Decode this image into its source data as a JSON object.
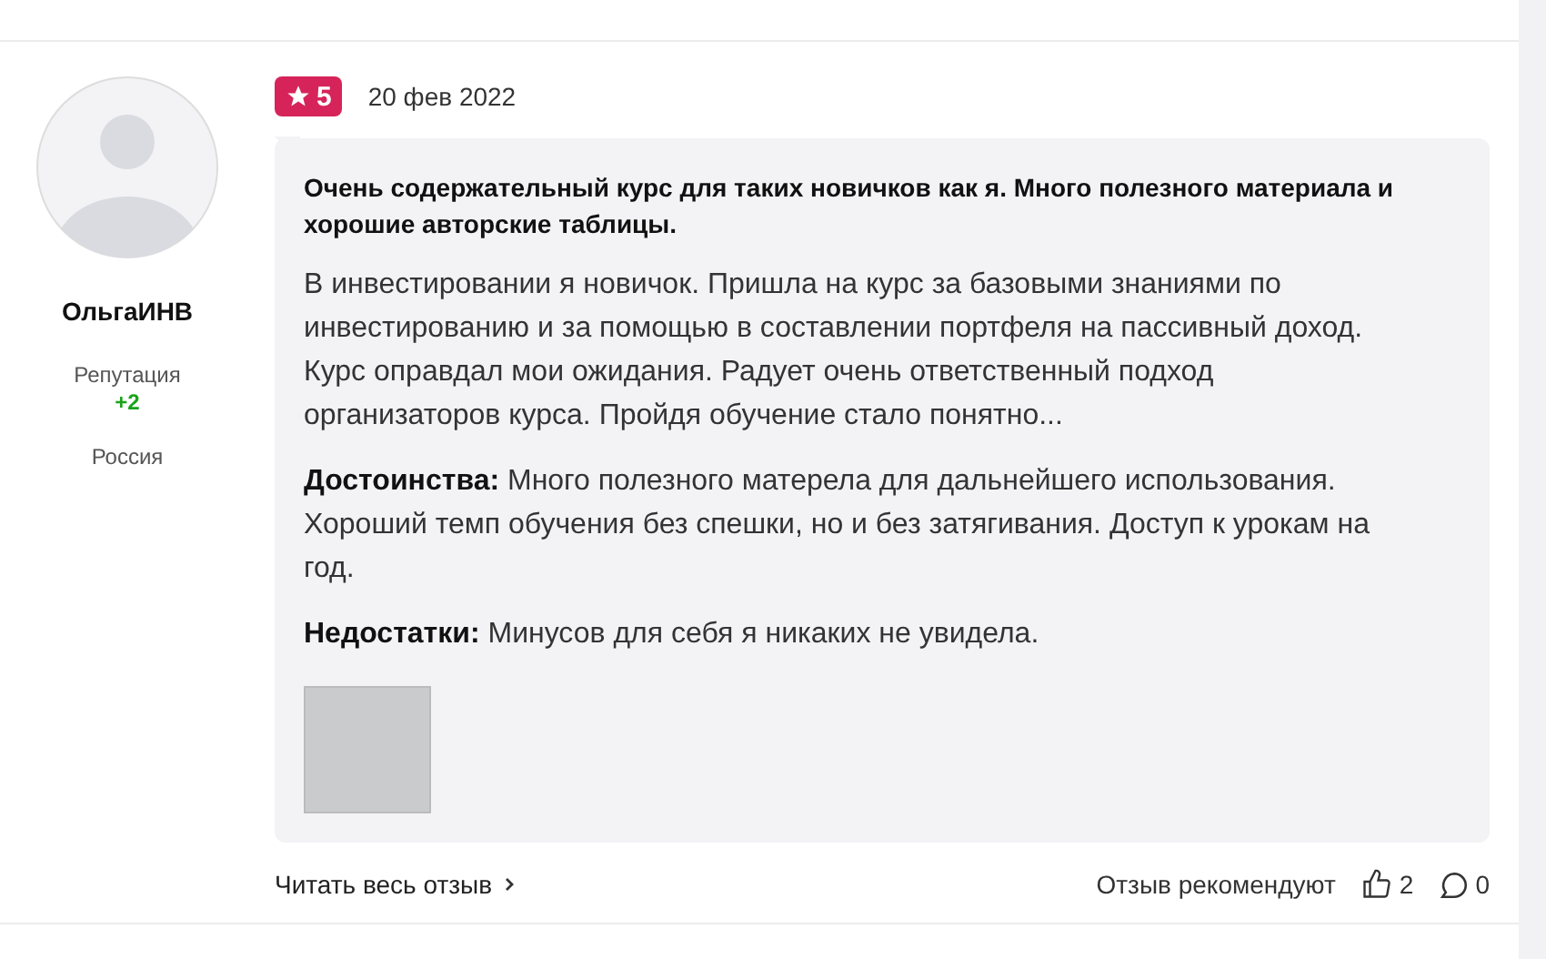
{
  "review": {
    "author": {
      "name": "ОльгаИНВ",
      "reputation_label": "Репутация",
      "reputation": "+2",
      "country": "Россия"
    },
    "rating": "5",
    "date": "20 фев 2022",
    "title": "Очень содержательный курс для таких новичков как я. Много полезного материала и хорошие авторские таблицы.",
    "body": "В инвестировании я новичок. Пришла на курс за базовыми знаниями по инвестированию и за помощью в составлении портфеля на пассивный доход. Курс оправдал мои ожидания. Радует очень ответственный подход организаторов курса. Пройдя обучение стало понятно...",
    "pros": "**Достоинства:** Много полезного матерела для дальнейшего использования. Хороший темп обучения без спешки, но и без затягивания. Доступ к урокам на год.",
    "cons": "**Недостатки:** Минусов для себя я никаких не увидела.",
    "read_more": "Читать весь отзыв",
    "recommend_label": "Отзыв рекомендуют",
    "likes": "2",
    "comments": "0"
  }
}
